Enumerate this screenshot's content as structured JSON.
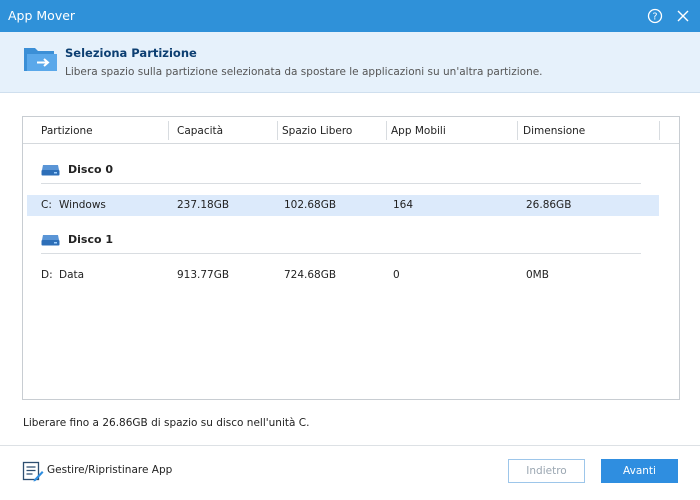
{
  "window": {
    "title": "App Mover",
    "help_icon": "help-circle-icon",
    "close_icon": "close-icon"
  },
  "banner": {
    "icon": "folder-arrow-icon",
    "title": "Seleziona Partizione",
    "subtitle": "Libera spazio sulla partizione selezionata da spostare le applicazioni su un'altra partizione."
  },
  "table": {
    "columns": [
      "Partizione",
      "Capacità",
      "Spazio Libero",
      "App Mobili",
      "Dimensione"
    ],
    "disks": [
      {
        "label": "Disco 0",
        "icon": "disk-drive-icon",
        "partitions": [
          {
            "letter": "C:",
            "name": "Windows",
            "capacity": "237.18GB",
            "free": "102.68GB",
            "apps": "164",
            "size": "26.86GB",
            "selected": true
          }
        ]
      },
      {
        "label": "Disco 1",
        "icon": "disk-drive-icon",
        "partitions": [
          {
            "letter": "D:",
            "name": "Data",
            "capacity": "913.77GB",
            "free": "724.68GB",
            "apps": "0",
            "size": "0MB",
            "selected": false
          }
        ]
      }
    ]
  },
  "status_text": "Liberare fino a 26.86GB di spazio su disco nell'unità C.",
  "footer": {
    "manage_label": "Gestire/Ripristinare App",
    "manage_icon": "list-edit-icon",
    "back_label": "Indietro",
    "next_label": "Avanti"
  },
  "colors": {
    "titlebar": "#2f91d9",
    "banner_bg": "#e6f1fb",
    "selected_row": "#dceafb",
    "primary_button": "#2f8ee0"
  }
}
